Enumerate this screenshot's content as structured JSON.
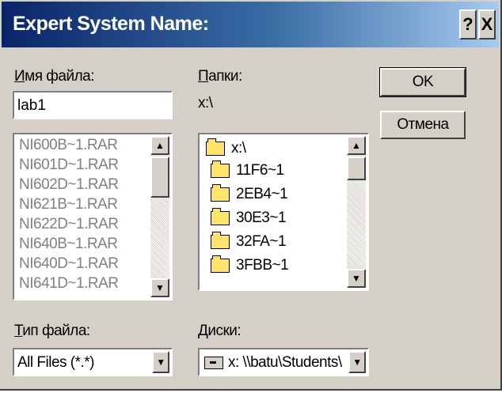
{
  "window": {
    "title": "Expert System Name:",
    "help_btn": "?",
    "close_btn": "X"
  },
  "filename": {
    "label_accel": "И",
    "label_rest": "мя файла:",
    "value": "lab1",
    "files": [
      "NI600B~1.RAR",
      "NI601D~1.RAR",
      "NI602D~1.RAR",
      "NI621B~1.RAR",
      "NI622D~1.RAR",
      "NI640B~1.RAR",
      "NI640D~1.RAR",
      "NI641D~1.RAR"
    ]
  },
  "folders": {
    "label_accel": "П",
    "label_rest": "апки:",
    "current_path": "x:\\",
    "items": [
      "x:\\",
      "11F6~1",
      "2EB4~1",
      "30E3~1",
      "32FA~1",
      "3FBB~1"
    ]
  },
  "buttons": {
    "ok": "OK",
    "cancel": "Отмена"
  },
  "filetype": {
    "label_accel": "Т",
    "label_rest": "ип файла:",
    "value": "All Files (*.*)"
  },
  "drives": {
    "label_accel": "Д",
    "label_rest": "иски:",
    "value": "x: \\\\batu\\Students\\"
  }
}
